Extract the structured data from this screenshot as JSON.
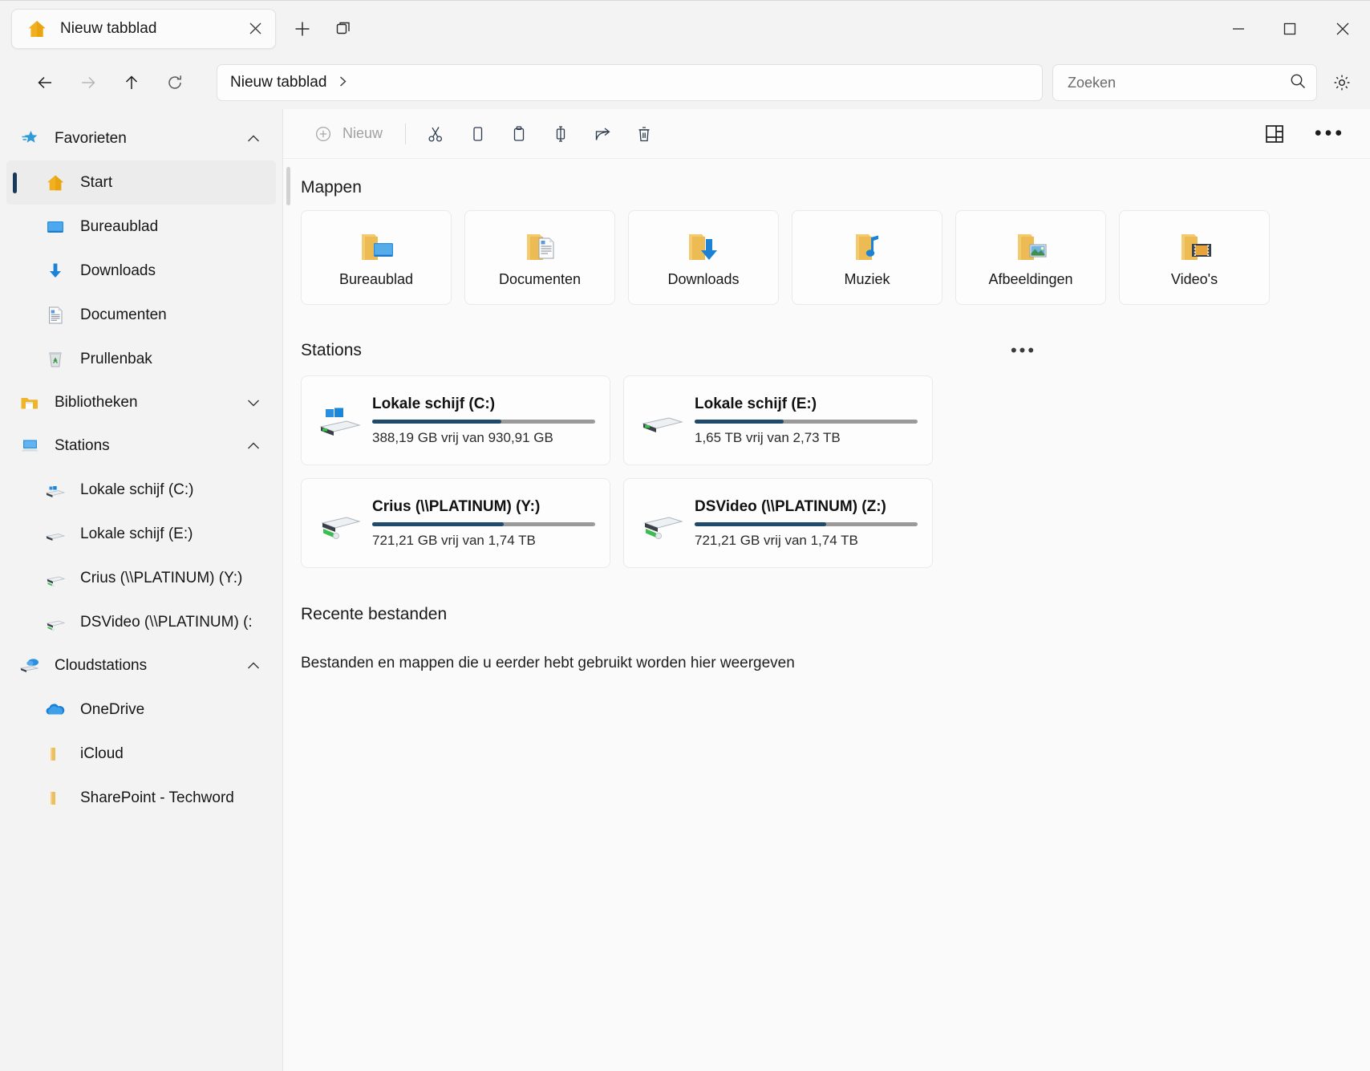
{
  "window": {
    "tab": {
      "title": "Nieuw tabblad",
      "home_icon": "home-icon",
      "close_icon": "close-icon"
    },
    "new_tab_icon": "plus-icon",
    "tab_list_icon": "tab-list-icon",
    "controls": {
      "minimize": "minimize-icon",
      "maximize": "maximize-icon",
      "close": "close-icon"
    }
  },
  "address": {
    "back": "back-arrow-icon",
    "forward": "forward-arrow-icon",
    "up": "up-arrow-icon",
    "refresh": "refresh-icon",
    "breadcrumb": "Nieuw tabblad",
    "breadcrumb_chevron": "chevron-right-icon",
    "settings_icon": "gear-icon"
  },
  "search": {
    "placeholder": "Zoeken",
    "value": "",
    "icon": "search-icon"
  },
  "toolbar": {
    "new_label": "Nieuw",
    "new_icon": "plus-circle-icon",
    "actions": [
      {
        "name": "cut-button",
        "icon": "scissors-icon"
      },
      {
        "name": "copy-button",
        "icon": "copy-icon"
      },
      {
        "name": "paste-button",
        "icon": "paste-icon"
      },
      {
        "name": "rename-button",
        "icon": "rename-icon"
      },
      {
        "name": "share-button",
        "icon": "share-icon"
      },
      {
        "name": "delete-button",
        "icon": "trash-icon"
      }
    ],
    "layout_icon": "layout-view-icon",
    "more_label": "•••"
  },
  "sidebar": {
    "groups": [
      {
        "label": "Favorieten",
        "icon": "favorites-star-icon",
        "chevron": "˄",
        "expanded": true,
        "items": [
          {
            "label": "Start",
            "icon": "home-icon",
            "selected": true
          },
          {
            "label": "Bureaublad",
            "icon": "desktop-icon",
            "selected": false
          },
          {
            "label": "Downloads",
            "icon": "downloads-arrow-icon",
            "selected": false
          },
          {
            "label": "Documenten",
            "icon": "document-icon",
            "selected": false
          },
          {
            "label": "Prullenbak",
            "icon": "recycle-bin-icon",
            "selected": false
          }
        ]
      },
      {
        "label": "Bibliotheken",
        "icon": "library-folder-icon",
        "chevron": "˅",
        "expanded": false,
        "items": []
      },
      {
        "label": "Stations",
        "icon": "this-pc-icon",
        "chevron": "˄",
        "expanded": true,
        "items": [
          {
            "label": "Lokale schijf (C:)",
            "icon": "windows-drive-icon",
            "selected": false
          },
          {
            "label": "Lokale schijf (E:)",
            "icon": "drive-icon",
            "selected": false
          },
          {
            "label": "Crius (\\\\PLATINUM) (Y:)",
            "icon": "network-drive-icon",
            "selected": false
          },
          {
            "label": "DSVideo (\\\\PLATINUM) (:",
            "icon": "network-drive-icon",
            "selected": false
          }
        ]
      },
      {
        "label": "Cloudstations",
        "icon": "cloud-drive-icon",
        "chevron": "˄",
        "expanded": true,
        "items": [
          {
            "label": "OneDrive",
            "icon": "onedrive-cloud-icon",
            "selected": false
          },
          {
            "label": "iCloud",
            "icon": "folder-icon",
            "selected": false
          },
          {
            "label": "SharePoint - Techword",
            "icon": "folder-icon",
            "selected": false
          }
        ]
      }
    ]
  },
  "main": {
    "folders_section_title": "Mappen",
    "folders": [
      {
        "name": "Bureaublad",
        "icon": "folder-desktop-icon"
      },
      {
        "name": "Documenten",
        "icon": "folder-documents-icon"
      },
      {
        "name": "Downloads",
        "icon": "folder-downloads-icon"
      },
      {
        "name": "Muziek",
        "icon": "folder-music-icon"
      },
      {
        "name": "Afbeeldingen",
        "icon": "folder-pictures-icon"
      },
      {
        "name": "Video's",
        "icon": "folder-videos-icon"
      }
    ],
    "drives_section_title": "Stations",
    "drives_more_label": "•••",
    "drives": [
      {
        "name": "Lokale schijf (C:)",
        "free": "388,19 GB vrij van 930,91 GB",
        "used_percent": 58,
        "icon": "windows-drive-icon"
      },
      {
        "name": "Lokale schijf (E:)",
        "free": "1,65 TB vrij van 2,73 TB",
        "used_percent": 40,
        "icon": "drive-icon"
      },
      {
        "name": "Crius (\\\\PLATINUM) (Y:)",
        "free": "721,21 GB vrij van 1,74 TB",
        "used_percent": 59,
        "icon": "network-drive-icon"
      },
      {
        "name": "DSVideo (\\\\PLATINUM) (Z:)",
        "free": "721,21 GB vrij van 1,74 TB",
        "used_percent": 59,
        "icon": "network-drive-icon"
      }
    ],
    "recent_section_title": "Recente bestanden",
    "recent_empty_message": "Bestanden en mappen die u eerder hebt gebruikt worden hier weergeven"
  },
  "colors": {
    "accent_selected_bar": "#17395c",
    "progress_fill": "#1f4a6b",
    "progress_track": "#9a9a9a",
    "folder_yellow": "#f7c861",
    "window_bg": "#f3f3f3"
  }
}
